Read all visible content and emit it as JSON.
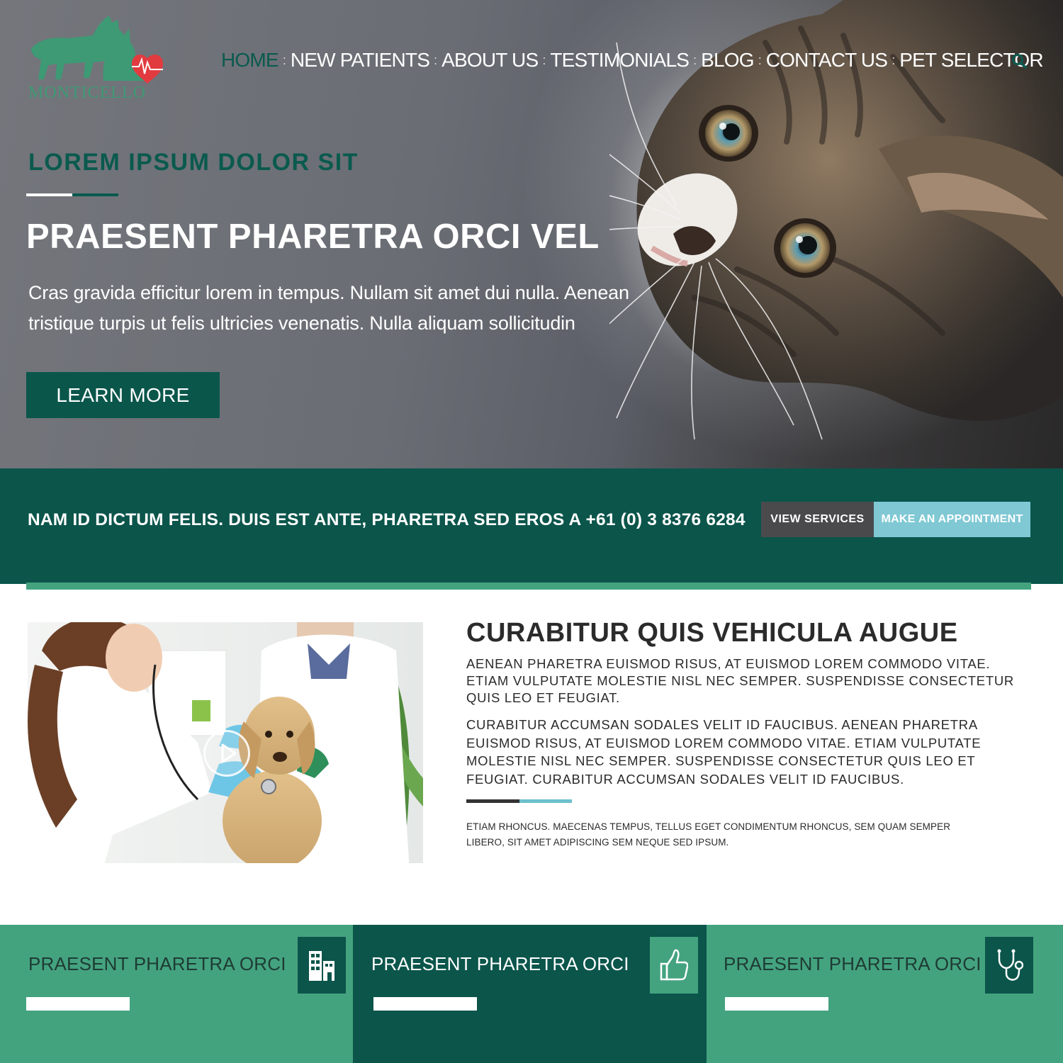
{
  "brand": {
    "name": "MONTICELLO"
  },
  "nav": {
    "items": [
      {
        "label": "HOME",
        "active": true
      },
      {
        "label": "NEW PATIENTS"
      },
      {
        "label": "ABOUT US"
      },
      {
        "label": "TESTIMONIALS"
      },
      {
        "label": "BLOG"
      },
      {
        "label": "CONTACT US"
      },
      {
        "label": "PET SELECTOR"
      }
    ],
    "separator": ":",
    "search_icon": "search-icon"
  },
  "hero": {
    "kicker": "LOREM IPSUM DOLOR SIT",
    "title": "PRAESENT PHARETRA ORCI VEL",
    "text": "Cras gravida efficitur lorem in tempus. Nullam sit amet dui nulla. Aenean tristique turpis ut felis ultricies venenatis. Nulla aliquam sollicitudin",
    "button": "LEARN MORE"
  },
  "cta": {
    "text": "NAM ID DICTUM FELIS. DUIS EST ANTE, PHARETRA SED EROS A +61 (0) 3 8376 6284",
    "view_services": "VIEW SERVICES",
    "make_appointment": "MAKE AN APPOINTMENT"
  },
  "about": {
    "title": "CURABITUR QUIS VEHICULA AUGUE",
    "paragraph1": "AENEAN PHARETRA EUISMOD RISUS, AT EUISMOD LOREM COMMODO VITAE. ETIAM VULPUTATE MOLESTIE NISL NEC SEMPER. SUSPENDISSE CONSECTETUR QUIS LEO ET FEUGIAT.",
    "paragraph2": "CURABITUR ACCUMSAN SODALES VELIT ID FAUCIBUS. AENEAN PHARETRA EUISMOD RISUS, AT EUISMOD LOREM COMMODO VITAE. ETIAM VULPUTATE MOLESTIE NISL NEC SEMPER. SUSPENDISSE CONSECTETUR QUIS LEO ET FEUGIAT. CURABITUR ACCUMSAN SODALES VELIT ID FAUCIBUS.",
    "small": "ETIAM RHONCUS. MAECENAS TEMPUS, TELLUS EGET CONDIMENTUM RHONCUS, SEM QUAM SEMPER LIBERO, SIT AMET ADIPISCING SEM NEQUE SED IPSUM.",
    "video_icon": "play-icon"
  },
  "features": [
    {
      "title": "PRAESENT PHARETRA ORCI",
      "icon": "building-icon"
    },
    {
      "title": "PRAESENT PHARETRA ORCI",
      "icon": "thumbs-up-icon"
    },
    {
      "title": "PRAESENT PHARETRA ORCI",
      "icon": "stethoscope-icon"
    }
  ],
  "colors": {
    "dark_teal": "#0b554b",
    "green": "#44a37f",
    "light_blue": "#7fc8d4",
    "gray_button": "#4a4a4c"
  }
}
